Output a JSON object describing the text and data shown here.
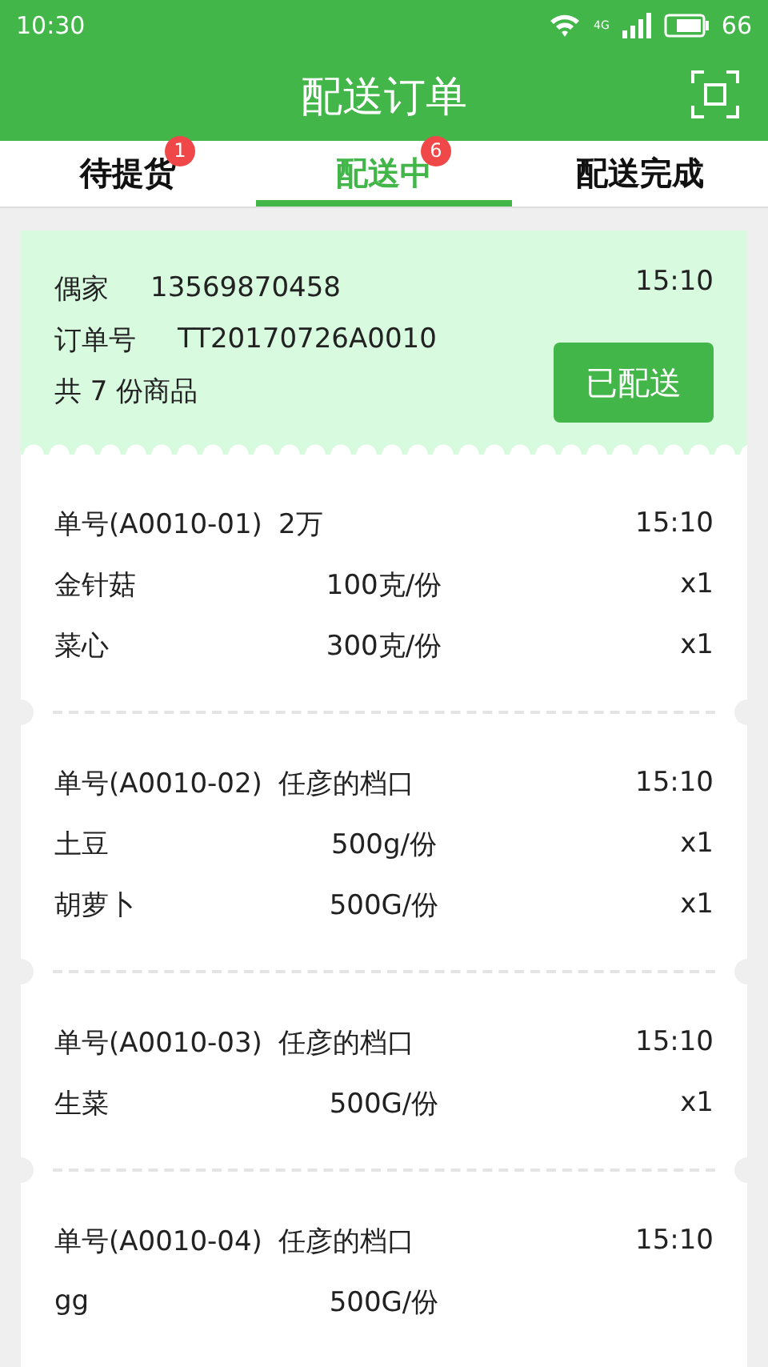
{
  "status_bar": {
    "time": "10:30",
    "network": "4G",
    "battery": "66"
  },
  "title": "配送订单",
  "tabs": [
    {
      "label": "待提货",
      "badge": "1",
      "selected": false
    },
    {
      "label": "配送中",
      "badge": "6",
      "selected": true
    },
    {
      "label": "配送完成",
      "selected": false
    }
  ],
  "order": {
    "customer": "偶家",
    "phone": "13569870458",
    "time": "15:10",
    "order_label": "订单号",
    "order_no": "TT20170726A0010",
    "summary": "共 7 份商品",
    "button": "已配送"
  },
  "sub_orders": [
    {
      "number": "单号(A0010-01)",
      "shop": "2万",
      "time": "15:10",
      "items": [
        {
          "name": "金针菇",
          "spec": "100克/份",
          "qty": "x1"
        },
        {
          "name": "菜心",
          "spec": "300克/份",
          "qty": "x1"
        }
      ]
    },
    {
      "number": "单号(A0010-02)",
      "shop": "任彦的档口",
      "time": "15:10",
      "items": [
        {
          "name": "土豆",
          "spec": "500g/份",
          "qty": "x1"
        },
        {
          "name": "胡萝卜",
          "spec": "500G/份",
          "qty": "x1"
        }
      ]
    },
    {
      "number": "单号(A0010-03)",
      "shop": "任彦的档口",
      "time": "15:10",
      "items": [
        {
          "name": "生菜",
          "spec": "500G/份",
          "qty": "x1"
        }
      ]
    },
    {
      "number": "单号(A0010-04)",
      "shop": "任彦的档口",
      "time": "15:10",
      "items": [
        {
          "name": "gg",
          "spec": "500G/份"
        }
      ]
    }
  ]
}
